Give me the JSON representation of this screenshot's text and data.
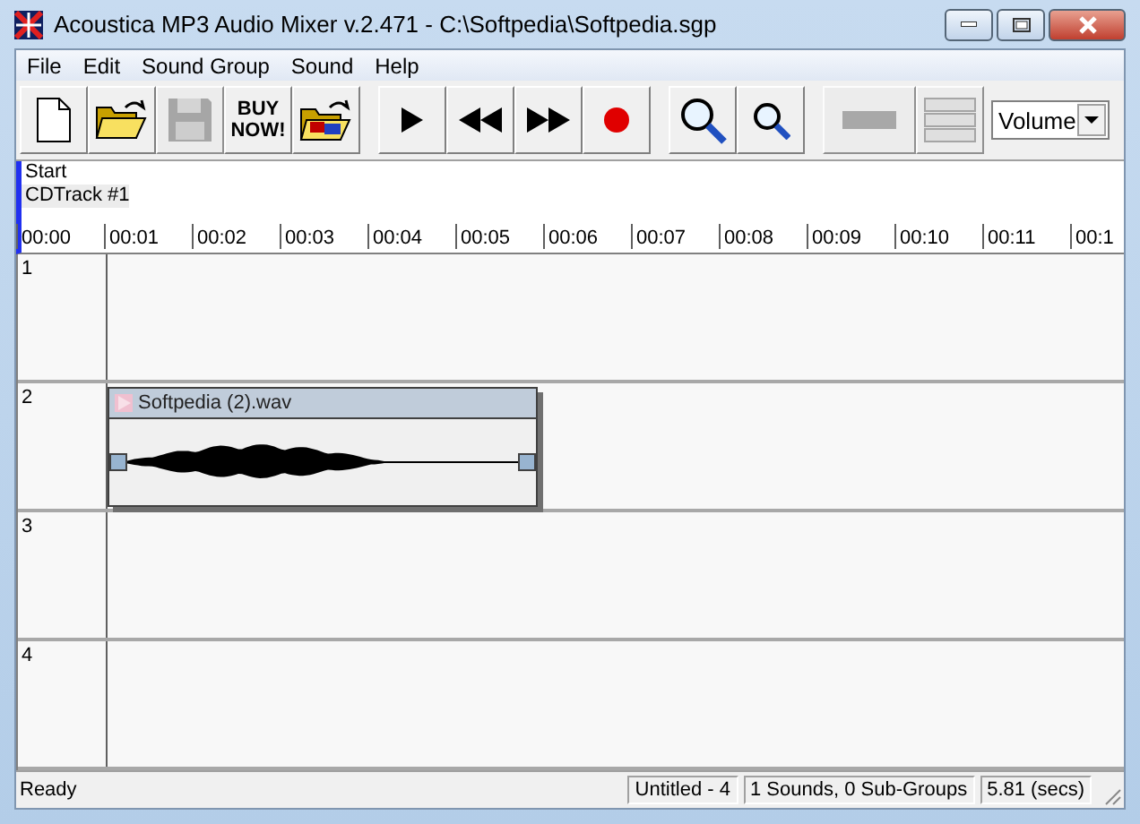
{
  "window": {
    "title": "Acoustica MP3 Audio Mixer v.2.471 - C:\\Softpedia\\Softpedia.sgp"
  },
  "menu": [
    "File",
    "Edit",
    "Sound Group",
    "Sound",
    "Help"
  ],
  "toolbar": [
    {
      "kind": "new",
      "disabled": false
    },
    {
      "kind": "open",
      "disabled": false
    },
    {
      "kind": "save",
      "disabled": true
    },
    {
      "kind": "buy",
      "label": "BUY NOW!",
      "disabled": false
    },
    {
      "kind": "import",
      "disabled": false
    },
    {
      "kind": "play",
      "disabled": false
    },
    {
      "kind": "rewind",
      "disabled": false
    },
    {
      "kind": "forward",
      "disabled": false
    },
    {
      "kind": "record",
      "disabled": false
    },
    {
      "kind": "zoom-in",
      "disabled": false
    },
    {
      "kind": "zoom-out",
      "disabled": false
    },
    {
      "kind": "bar",
      "disabled": true
    },
    {
      "kind": "grid",
      "disabled": true
    }
  ],
  "view_select": {
    "value": "Volume"
  },
  "timeline": {
    "marker": "Start",
    "track_name": "CDTrack #1",
    "ticks": [
      "00:00",
      "00:01",
      "00:02",
      "00:03",
      "00:04",
      "00:05",
      "00:06",
      "00:07",
      "00:08",
      "00:09",
      "00:10",
      "00:11",
      "00:1"
    ]
  },
  "tracks": [
    {
      "number": "1"
    },
    {
      "number": "2",
      "clip": {
        "name": "Softpedia (2).wav"
      }
    },
    {
      "number": "3"
    },
    {
      "number": "4"
    }
  ],
  "status_bar": [
    "Ready",
    "Untitled - 4",
    "1 Sounds, 0 Sub-Groups",
    "5.81 (secs)"
  ]
}
